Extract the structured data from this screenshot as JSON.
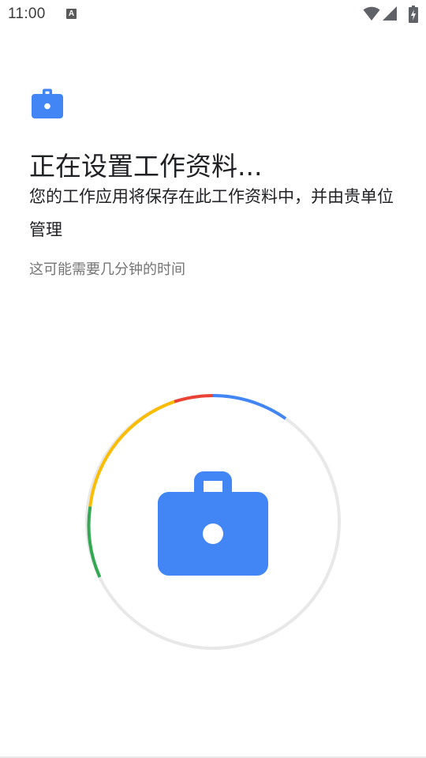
{
  "status_bar": {
    "time": "11:00",
    "notification_icon": "a-notification-icon",
    "notification_glyph": "A",
    "icons": [
      "wifi-icon",
      "cell-signal-icon",
      "battery-charging-icon"
    ]
  },
  "header": {
    "icon": "briefcase-icon",
    "title": "正在设置工作资料...",
    "description": "您的工作应用将保存在此工作资料中，并由贵单位管理",
    "note": "这可能需要几分钟的时间"
  },
  "progress": {
    "center_icon": "briefcase-icon",
    "colors": {
      "track": "#e8e8e8",
      "blue": "#4285f4",
      "red": "#ea4335",
      "yellow": "#fbbc04",
      "green": "#34a853"
    }
  },
  "colors": {
    "accent": "#4285f4",
    "title_text": "#202124",
    "secondary_text": "#757575"
  }
}
